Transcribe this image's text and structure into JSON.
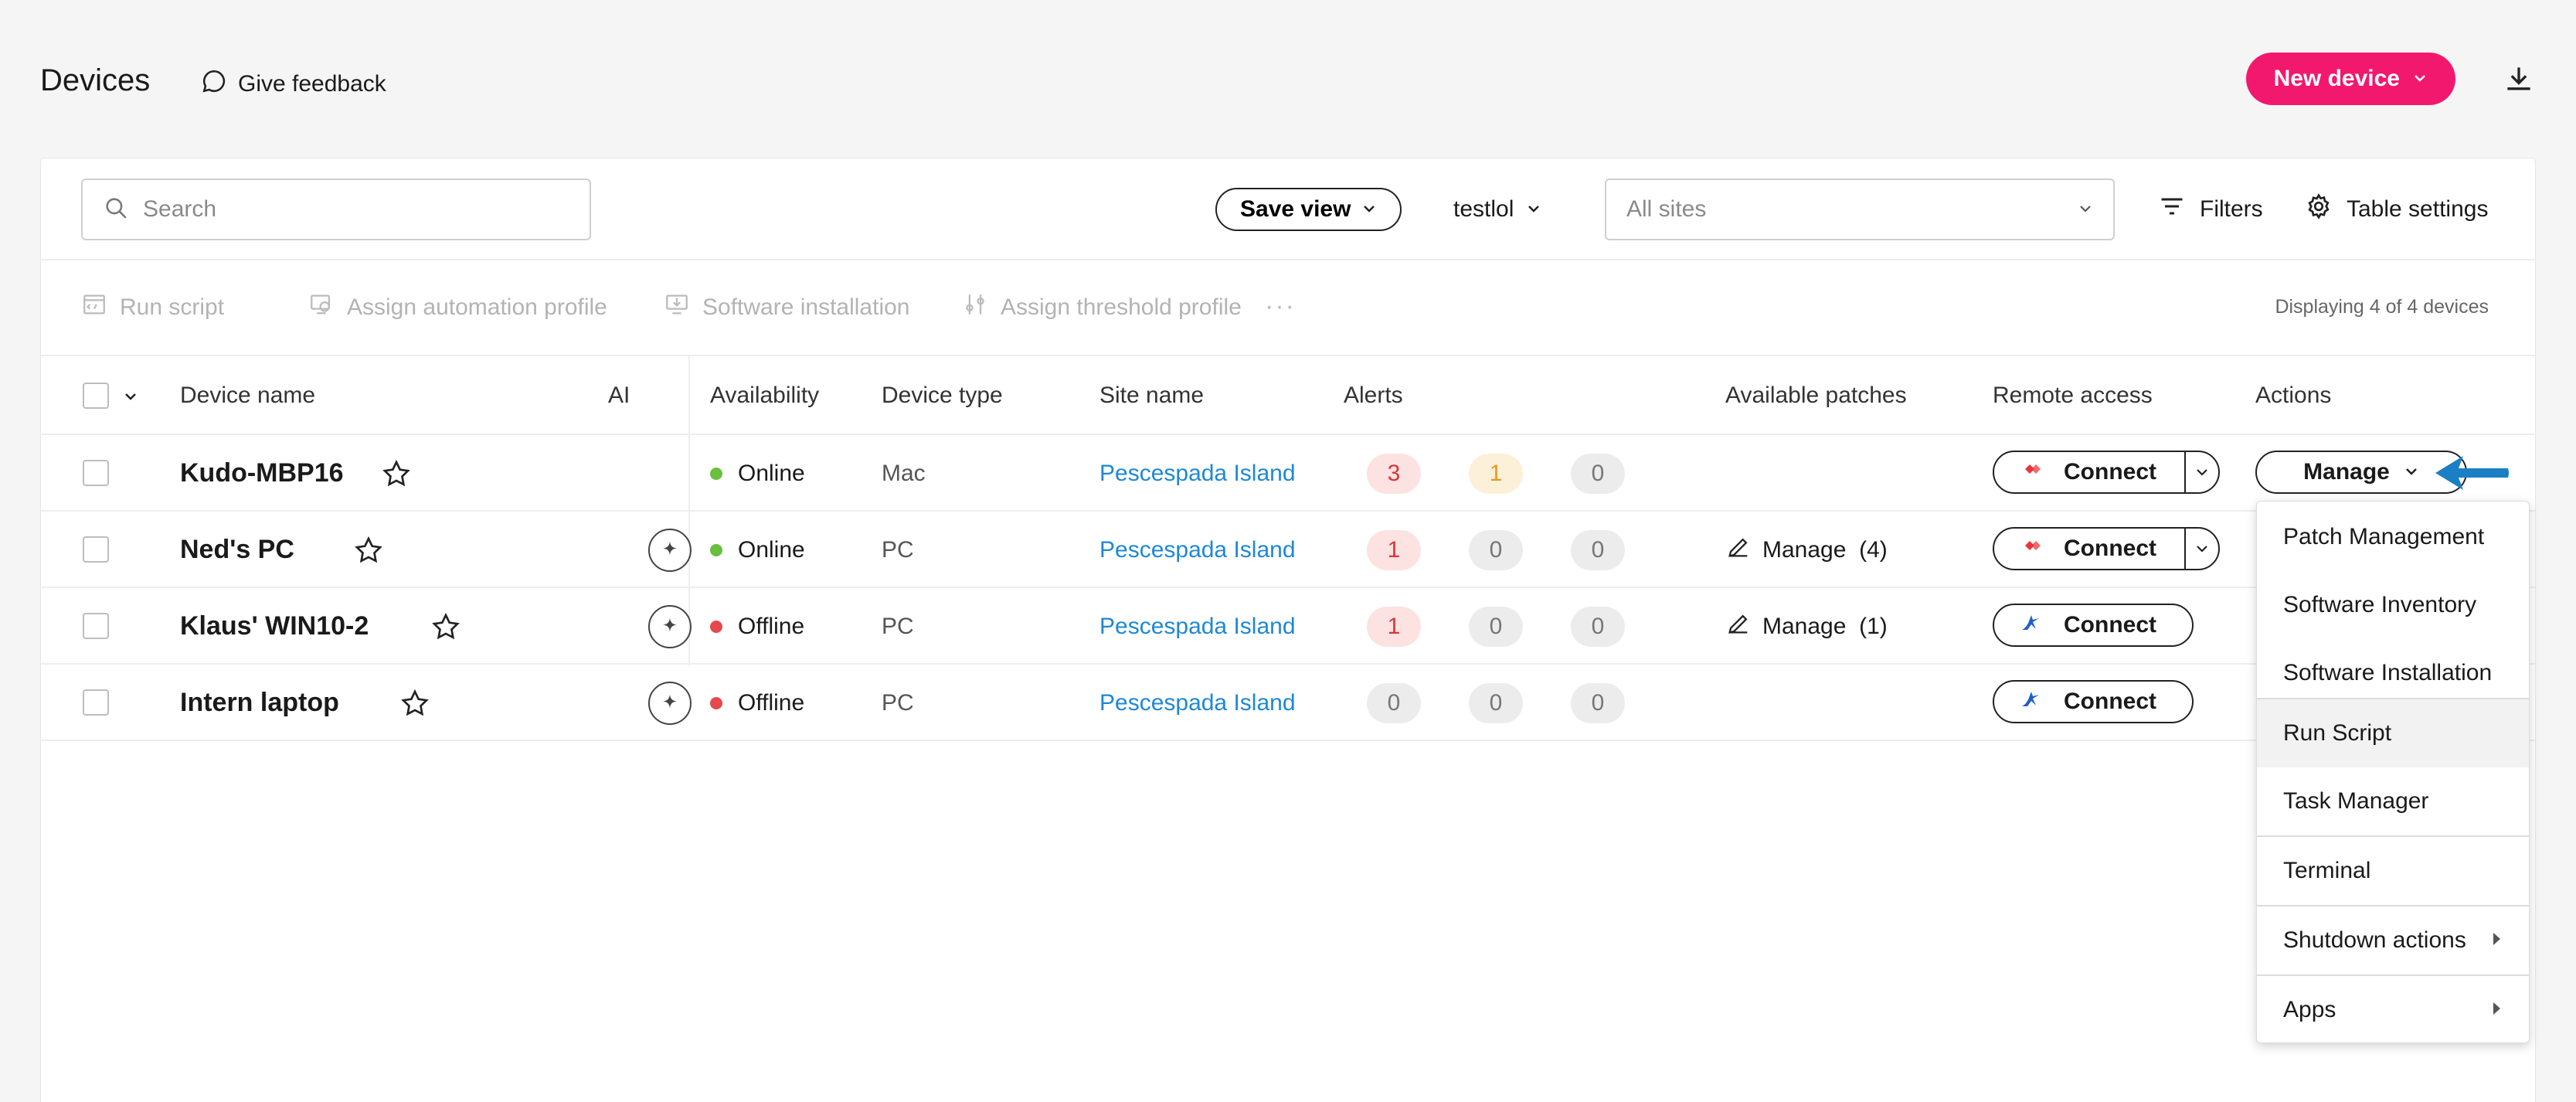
{
  "header": {
    "title": "Devices",
    "feedback_label": "Give feedback",
    "new_device_label": "New device"
  },
  "toolbar": {
    "search_placeholder": "Search",
    "save_view_label": "Save view",
    "view_name": "testlol",
    "sites_placeholder": "All sites",
    "filters_label": "Filters",
    "table_settings_label": "Table settings"
  },
  "bulk_actions": {
    "run_script": "Run script",
    "assign_automation": "Assign automation profile",
    "software_installation": "Software installation",
    "assign_threshold": "Assign threshold profile",
    "more": "···",
    "displaying": "Displaying 4 of 4 devices"
  },
  "columns": {
    "device_name": "Device name",
    "ai": "AI",
    "availability": "Availability",
    "device_type": "Device type",
    "site_name": "Site name",
    "alerts": "Alerts",
    "available_patches": "Available patches",
    "remote_access": "Remote access",
    "actions": "Actions"
  },
  "rows": [
    {
      "name": "Kudo-MBP16",
      "availability": "Online",
      "type": "Mac",
      "site": "Pescespada Island",
      "alerts": [
        "3",
        "1",
        "0"
      ],
      "patch_label": "",
      "patch_count": "",
      "connect_label": "Connect"
    },
    {
      "name": "Ned's PC",
      "availability": "Online",
      "type": "PC",
      "site": "Pescespada Island",
      "alerts": [
        "1",
        "0",
        "0"
      ],
      "patch_label": "Manage",
      "patch_count": "(4)",
      "connect_label": "Connect"
    },
    {
      "name": "Klaus' WIN10-2",
      "availability": "Offline",
      "type": "PC",
      "site": "Pescespada Island",
      "alerts": [
        "1",
        "0",
        "0"
      ],
      "patch_label": "Manage",
      "patch_count": "(1)",
      "connect_label": "Connect"
    },
    {
      "name": "Intern laptop",
      "availability": "Offline",
      "type": "PC",
      "site": "Pescespada Island",
      "alerts": [
        "0",
        "0",
        "0"
      ],
      "patch_label": "",
      "patch_count": "",
      "connect_label": "Connect"
    }
  ],
  "manage_button_label": "Manage",
  "menu": {
    "items": [
      "Patch Management",
      "Software Inventory",
      "Software Installation",
      "Run Script",
      "Task Manager",
      "Terminal",
      "Shutdown actions",
      "Apps"
    ]
  },
  "colors": {
    "brand": "#f2186d",
    "online": "#6abf3c",
    "offline": "#e5484d",
    "link": "#1e88d6",
    "alert_critical_bg": "#fde2e2",
    "alert_critical_fg": "#d93636",
    "alert_warning_bg": "#fdf0d9",
    "alert_warning_fg": "#e59a1e",
    "alert_neutral_bg": "#ececec",
    "alert_neutral_fg": "#777777"
  }
}
